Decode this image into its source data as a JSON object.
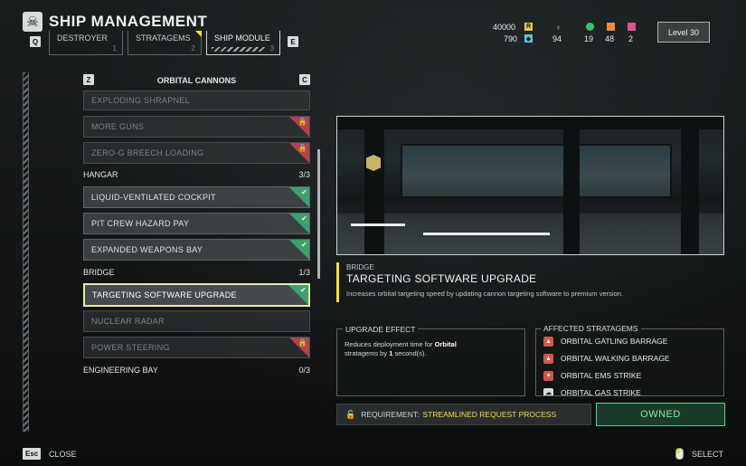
{
  "header": {
    "title": "SHIP MANAGEMENT",
    "key_prev": "Q",
    "key_next": "E",
    "tabs": [
      {
        "label": "DESTROYER",
        "num": "1"
      },
      {
        "label": "STRATAGEMS",
        "num": "2"
      },
      {
        "label": "SHIP MODULE",
        "num": "3"
      }
    ]
  },
  "resources": {
    "req_slips": "40000",
    "req_icon": "R",
    "super_credits": "790",
    "medals": "94",
    "samples_common": "19",
    "samples_rare": "48",
    "samples_super": "2",
    "level": "Level 30"
  },
  "list": {
    "key_left": "Z",
    "key_right": "C",
    "category": "ORBITAL CANNONS",
    "items_top": [
      {
        "label": "EXPLODING SHRAPNEL",
        "state": "dim"
      },
      {
        "label": "MORE GUNS",
        "state": "locked"
      },
      {
        "label": "ZERO-G BREECH LOADING",
        "state": "locked"
      }
    ],
    "hangar": {
      "label": "HANGAR",
      "count": "3/3"
    },
    "items_hangar": [
      {
        "label": "LIQUID-VENTILATED COCKPIT",
        "state": "owned"
      },
      {
        "label": "PIT CREW HAZARD PAY",
        "state": "owned"
      },
      {
        "label": "EXPANDED WEAPONS BAY",
        "state": "owned"
      }
    ],
    "bridge": {
      "label": "BRIDGE",
      "count": "1/3"
    },
    "items_bridge": [
      {
        "label": "TARGETING SOFTWARE UPGRADE",
        "state": "selected"
      },
      {
        "label": "NUCLEAR RADAR",
        "state": "dim"
      },
      {
        "label": "POWER STEERING",
        "state": "locked"
      }
    ],
    "engineering": {
      "label": "ENGINEERING BAY",
      "count": "0/3"
    }
  },
  "detail": {
    "category": "BRIDGE",
    "title": "TARGETING SOFTWARE UPGRADE",
    "description": "Increases orbital targeting speed by updating cannon targeting software to premium version.",
    "effect_header": "UPGRADE EFFECT",
    "effect_pre": "Reduces deployment time for ",
    "effect_bold1": "Orbital",
    "effect_mid": " stratagems by ",
    "effect_bold2": "1",
    "effect_post": " second(s).",
    "affected_header": "AFFECTED STRATAGEMS",
    "stratagems": [
      "ORBITAL GATLING BARRAGE",
      "ORBITAL WALKING BARRAGE",
      "ORBITAL EMS STRIKE",
      "ORBITAL GAS STRIKE"
    ],
    "requirement_label": "REQUIREMENT:",
    "requirement_value": "STREAMLINED REQUEST PROCESS",
    "owned_label": "OWNED"
  },
  "footer": {
    "close_key": "Esc",
    "close_label": "CLOSE",
    "select_label": "SELECT"
  },
  "colors": {
    "accent": "#f3df3f",
    "owned": "#3ea06c",
    "locked": "#b3434a",
    "owned_button_text": "#7ff0a6"
  }
}
